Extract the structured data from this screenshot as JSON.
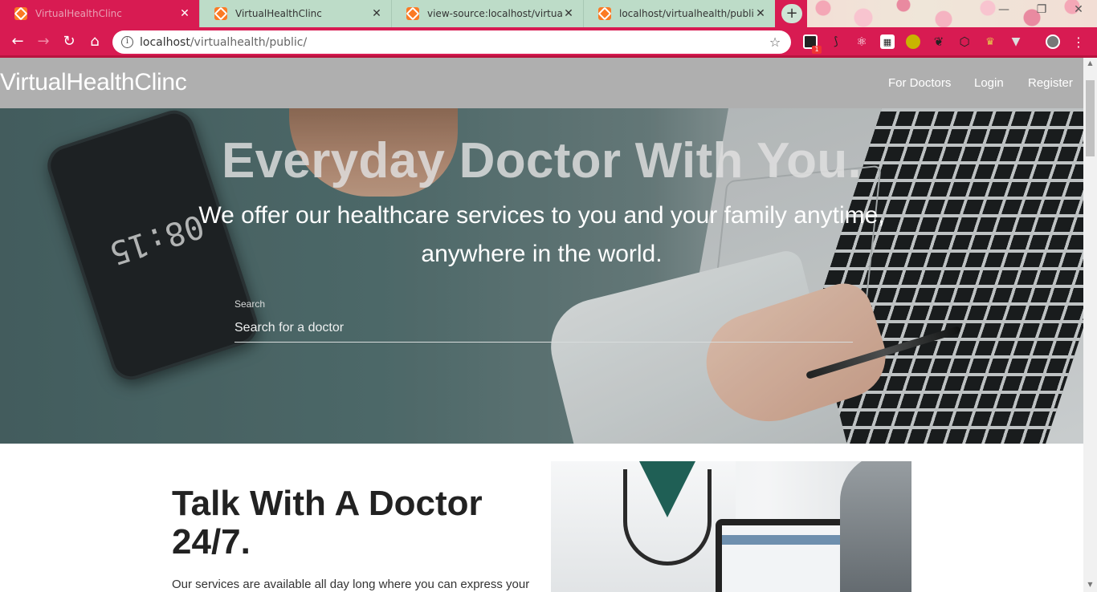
{
  "browser": {
    "tabs": [
      {
        "title": "VirtualHealthClinc",
        "active": true
      },
      {
        "title": "VirtualHealthClinc",
        "active": false
      },
      {
        "title": "view-source:localhost/virtualheal",
        "active": false
      },
      {
        "title": "localhost/virtualhealth/public/css",
        "active": false
      }
    ],
    "new_tab": "+",
    "window_controls": {
      "minimize": "—",
      "restore": "❐",
      "close": "✕"
    },
    "url_host": "localhost",
    "url_path": "/virtualhealth/public/",
    "extension_badge": "1",
    "accent_color": "#d81b52"
  },
  "site": {
    "brand": "VirtualHealthClinc",
    "nav": {
      "for_doctors": "For Doctors",
      "login": "Login",
      "register": "Register"
    }
  },
  "hero": {
    "title": "Everyday Doctor With You.",
    "subtitle": "We offer our healthcare services to you and your family anytime, anywhere in the world.",
    "phone_time": "08:15",
    "search": {
      "label": "Search",
      "placeholder": "Search for a doctor"
    }
  },
  "section": {
    "title": "Talk With A Doctor 24/7.",
    "text": "Our services are available all day long where you can express your"
  }
}
